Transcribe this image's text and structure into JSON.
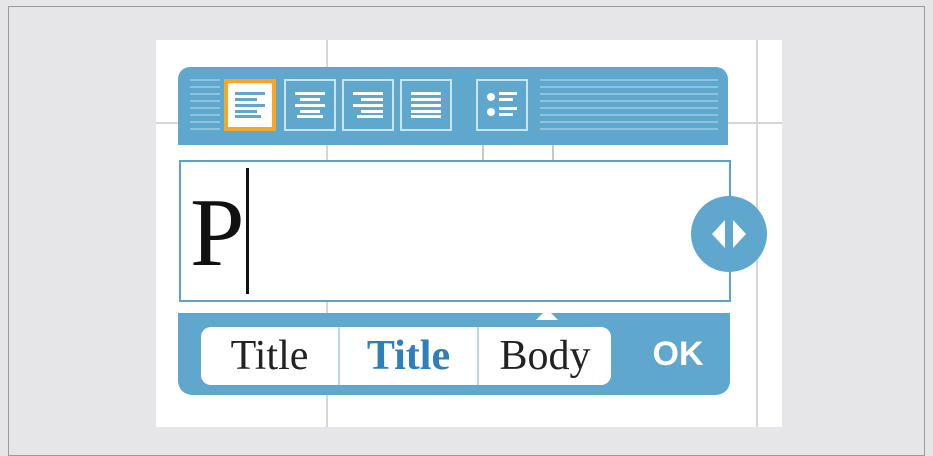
{
  "toolbar": {
    "buttons": [
      {
        "name": "align-left",
        "icon": "align-left-icon",
        "selected": true
      },
      {
        "name": "align-center",
        "icon": "align-center-icon",
        "selected": false
      },
      {
        "name": "align-right",
        "icon": "align-right-icon",
        "selected": false
      },
      {
        "name": "align-justify",
        "icon": "align-justify-icon",
        "selected": false
      },
      {
        "name": "bullet-list",
        "icon": "bullet-list-icon",
        "selected": false
      }
    ]
  },
  "editor": {
    "text": "P"
  },
  "style_picker": {
    "options": [
      {
        "label": "Title",
        "selected": false
      },
      {
        "label": "Title",
        "selected": true
      },
      {
        "label": "Body",
        "selected": false
      }
    ],
    "ok_label": "OK"
  },
  "colors": {
    "accent": "#5fa7cd",
    "selection_border": "#f6a821",
    "selected_text": "#2f7fbc"
  }
}
